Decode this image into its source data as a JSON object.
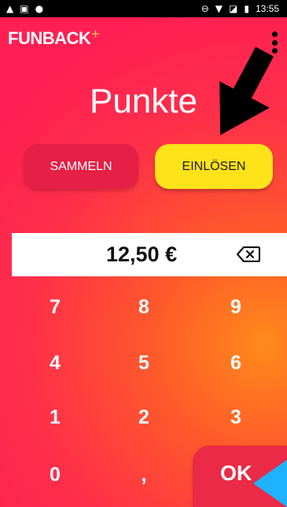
{
  "status_bar": {
    "time": "13:55",
    "left_icons": [
      "alert-icon",
      "image-icon",
      "dot-icon"
    ],
    "right_icons": [
      "do-not-disturb-icon",
      "wifi-icon",
      "no-sim-icon",
      "battery-icon"
    ]
  },
  "app": {
    "logo_text": "FUNBACK",
    "logo_plus": "+",
    "menu_icon": "more-vert-icon"
  },
  "page": {
    "title": "Punkte"
  },
  "mode_buttons": {
    "collect_label": "SAMMELN",
    "redeem_label": "EINLÖSEN",
    "selected": "EINLÖSEN"
  },
  "amount": {
    "value": "12,50 €",
    "backspace_icon": "backspace-icon"
  },
  "keypad": {
    "keys": [
      "7",
      "8",
      "9",
      "4",
      "5",
      "6",
      "1",
      "2",
      "3",
      "0",
      ","
    ],
    "ok_label": "OK"
  },
  "colors": {
    "background_primary": "#ff1f53",
    "background_accent": "#ff8a1a",
    "selected_button": "#ffe31a",
    "unselected_button": "#e51f45",
    "amount_bar": "#ffffff",
    "pointer_cursor": "#1fb2ff"
  }
}
